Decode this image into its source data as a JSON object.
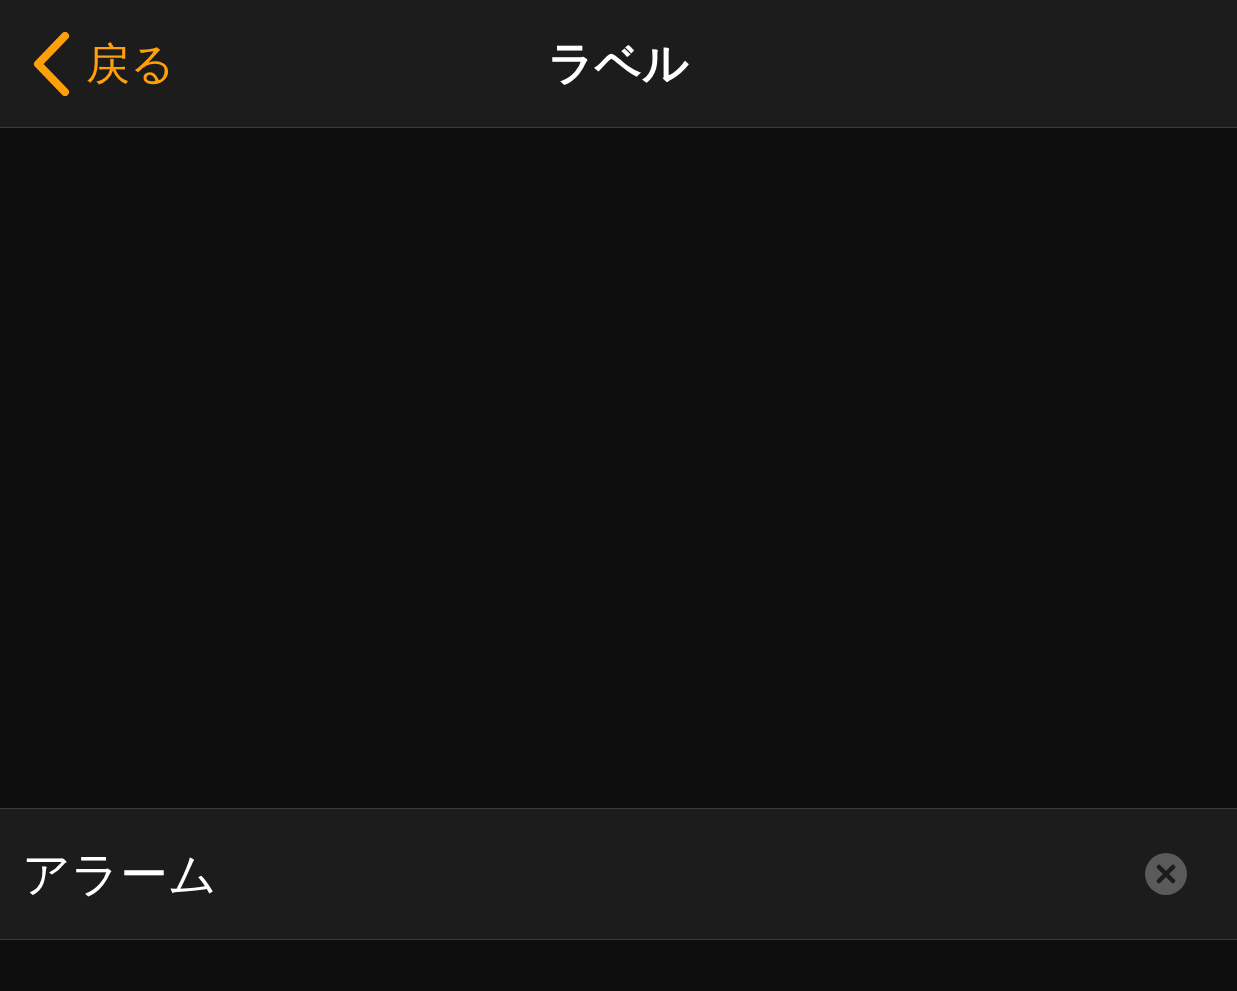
{
  "nav": {
    "back": "戻る",
    "title": "ラベル"
  },
  "field": {
    "value": "アラーム"
  }
}
